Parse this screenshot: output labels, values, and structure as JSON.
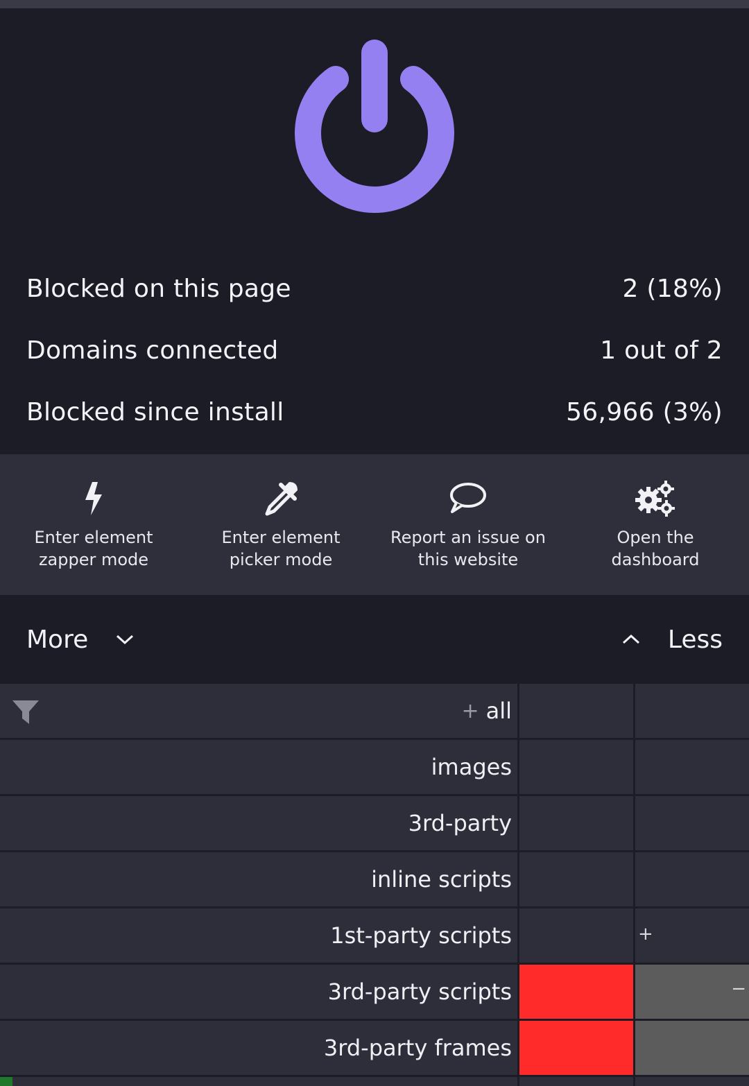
{
  "colors": {
    "accent_power": "#9580f2",
    "block_red": "#ff2a2a",
    "noop_gray": "#5c5c5c",
    "background": "#1c1c26",
    "toolbar_background": "#2f2f3b"
  },
  "power": {
    "icon": "power-icon",
    "state": "on"
  },
  "stats": [
    {
      "label": "Blocked on this page",
      "value": "2 (18%)"
    },
    {
      "label": "Domains connected",
      "value": "1 out of 2"
    },
    {
      "label": "Blocked since install",
      "value": "56,966 (3%)"
    }
  ],
  "tools": [
    {
      "icon": "lightning-bolt-icon",
      "label": "Enter element\nzapper mode"
    },
    {
      "icon": "eyedropper-icon",
      "label": "Enter element\npicker mode"
    },
    {
      "icon": "speech-bubble-icon",
      "label": "Report an issue on\nthis website"
    },
    {
      "icon": "gears-icon",
      "label": "Open the\ndashboard"
    }
  ],
  "expand": {
    "more_label": "More",
    "less_label": "Less"
  },
  "filters": {
    "all_plus": "+",
    "rows": [
      {
        "label": "all",
        "global": "",
        "local": ""
      },
      {
        "label": "images",
        "global": "",
        "local": ""
      },
      {
        "label": "3rd-party",
        "global": "",
        "local": ""
      },
      {
        "label": "inline scripts",
        "global": "",
        "local": ""
      },
      {
        "label": "1st-party scripts",
        "global": "",
        "local": "+"
      },
      {
        "label": "3rd-party scripts",
        "global": "block",
        "local": "noop",
        "local_mark": "−"
      },
      {
        "label": "3rd-party frames",
        "global": "block",
        "local": "noop"
      }
    ]
  }
}
